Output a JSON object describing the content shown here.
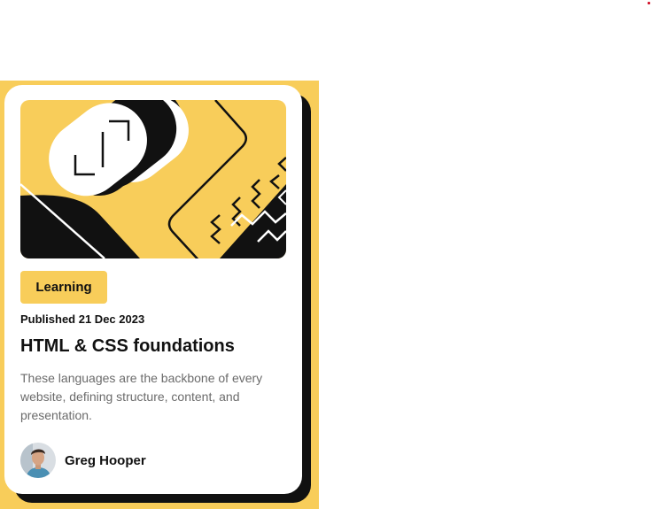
{
  "colors": {
    "page_background": "#ffffff",
    "accent_yellow": "#f8cd5a",
    "card": "#ffffff",
    "shadow": "#111111",
    "text_dark": "#111111",
    "text_muted": "#6b6b6b",
    "indicator_red": "#d0021b"
  },
  "card": {
    "illustration_icon": "abstract-tech-illustration",
    "tag_label": "Learning",
    "published": "Published 21 Dec 2023",
    "title": "HTML & CSS foundations",
    "description": "These languages are the backbone of every website, defining structure, content, and presentation.",
    "author": {
      "name": "Greg Hooper",
      "avatar_icon": "author-avatar"
    }
  }
}
